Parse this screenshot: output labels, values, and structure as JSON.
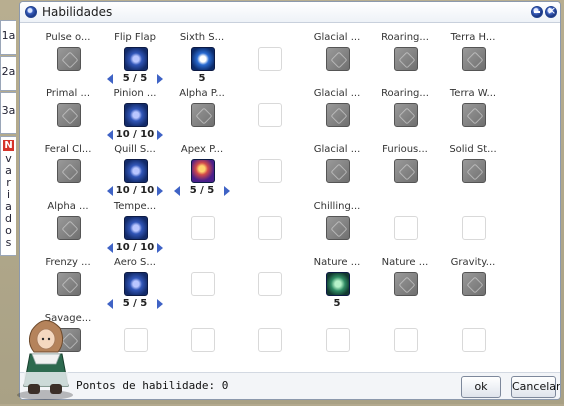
{
  "window": {
    "title": "Habilidades",
    "side_tabs": [
      {
        "label": "1a"
      },
      {
        "label": "2a"
      },
      {
        "label": "3a"
      },
      {
        "badge": "N",
        "label": "variados"
      }
    ]
  },
  "skills": {
    "grid": [
      [
        {
          "name": "Pulse o...",
          "state": "gray"
        },
        {
          "name": "Flip Flap",
          "state": "color",
          "level": "5 / 5",
          "arrows": true
        },
        {
          "name": "Sixth S...",
          "state": "color",
          "variant": "sixth",
          "level": "5"
        },
        {
          "name": "",
          "state": "empty"
        },
        {
          "name": "Glacial ...",
          "state": "gray"
        },
        {
          "name": "Roaring...",
          "state": "gray"
        },
        {
          "name": "Terra H...",
          "state": "gray"
        }
      ],
      [
        {
          "name": "Primal ...",
          "state": "gray"
        },
        {
          "name": "Pinion ...",
          "state": "color",
          "level": "10 / 10",
          "arrows": true
        },
        {
          "name": "Alpha P...",
          "state": "gray"
        },
        {
          "name": "",
          "state": "empty"
        },
        {
          "name": "Glacial ...",
          "state": "gray"
        },
        {
          "name": "Roaring...",
          "state": "gray"
        },
        {
          "name": "Terra W...",
          "state": "gray"
        }
      ],
      [
        {
          "name": "Feral Cl...",
          "state": "gray"
        },
        {
          "name": "Quill S...",
          "state": "color",
          "level": "10 / 10",
          "arrows": true
        },
        {
          "name": "Apex P...",
          "state": "color",
          "variant": "apex",
          "level": "5 / 5",
          "arrows": true
        },
        {
          "name": "",
          "state": "empty"
        },
        {
          "name": "Glacial ...",
          "state": "gray"
        },
        {
          "name": "Furious...",
          "state": "gray"
        },
        {
          "name": "Solid St...",
          "state": "gray"
        }
      ],
      [
        {
          "name": "Alpha ...",
          "state": "gray"
        },
        {
          "name": "Tempe...",
          "state": "color",
          "level": "10 / 10",
          "arrows": true
        },
        {
          "name": "",
          "state": "empty"
        },
        {
          "name": "",
          "state": "empty"
        },
        {
          "name": "Chilling...",
          "state": "gray"
        },
        {
          "name": "",
          "state": "empty"
        },
        {
          "name": "",
          "state": "empty"
        }
      ],
      [
        {
          "name": "Frenzy ...",
          "state": "gray"
        },
        {
          "name": "Aero S...",
          "state": "color",
          "level": "5 / 5",
          "arrows": true
        },
        {
          "name": "",
          "state": "empty"
        },
        {
          "name": "",
          "state": "empty"
        },
        {
          "name": "Nature ...",
          "state": "color",
          "variant": "nature",
          "level": "5"
        },
        {
          "name": "Nature ...",
          "state": "gray"
        },
        {
          "name": "Gravity...",
          "state": "gray"
        }
      ],
      [
        {
          "name": "Savage...",
          "state": "gray"
        },
        {
          "name": "",
          "state": "empty"
        },
        {
          "name": "",
          "state": "empty"
        },
        {
          "name": "",
          "state": "empty"
        },
        {
          "name": "",
          "state": "empty"
        },
        {
          "name": "",
          "state": "empty"
        },
        {
          "name": "",
          "state": "empty"
        }
      ]
    ]
  },
  "footer": {
    "points_label": "Pontos de habilidade: 0",
    "ok_label": "ok",
    "cancel_label": "Cancelar"
  },
  "icons": {
    "title_icon": "window-orb-icon",
    "minimize_icon": "minimize-icon",
    "close_icon": "close-icon"
  }
}
